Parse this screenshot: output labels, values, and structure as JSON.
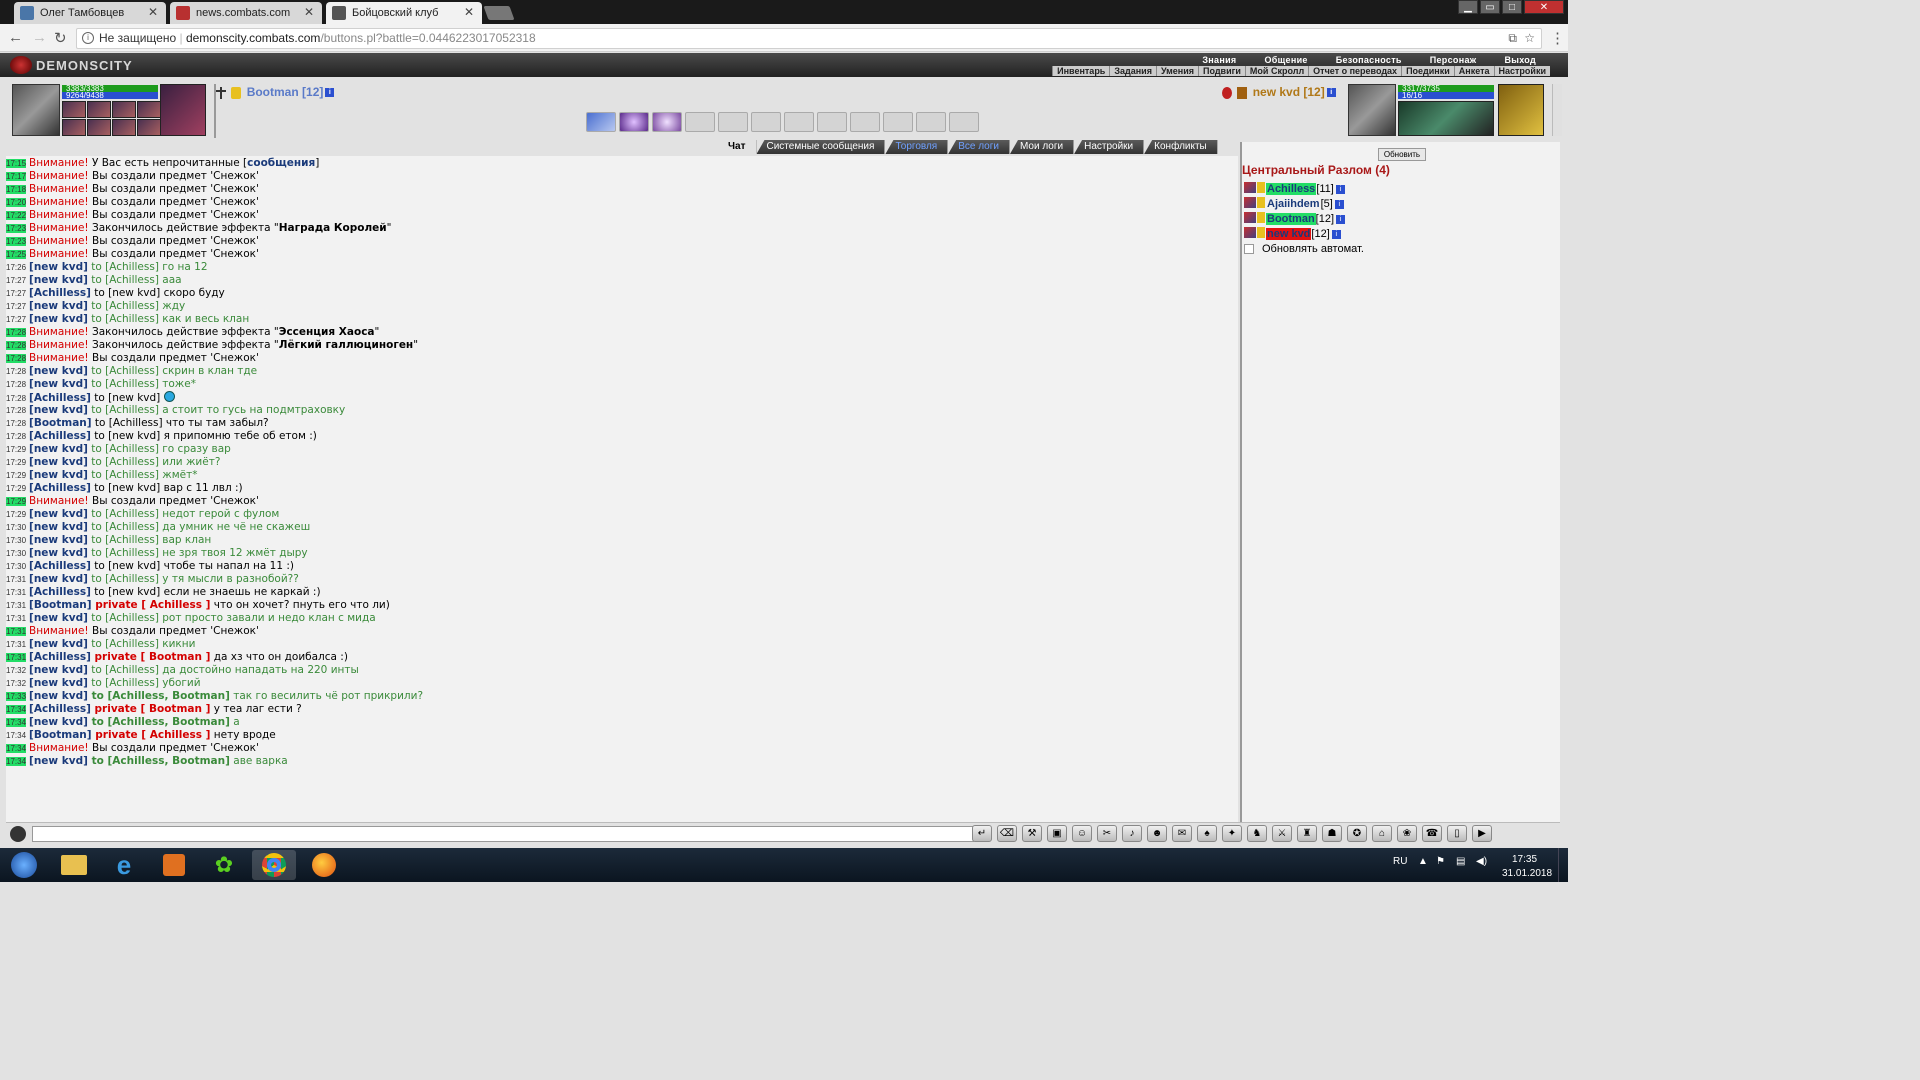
{
  "browser": {
    "tabs": [
      {
        "title": "Олег Тамбовцев",
        "fav": "#4a76a8"
      },
      {
        "title": "news.combats.com",
        "fav": "#b83030"
      },
      {
        "title": "Бойцовский клуб",
        "fav": "#555555"
      }
    ],
    "security": "Не защищено",
    "url_host": "demonscity.combats.com",
    "url_rest": "/buttons.pl?battle=0.0446223017052318"
  },
  "game": {
    "logo": "DEMONSCITY",
    "menu_top": [
      "Знания",
      "Общение",
      "Безопасность",
      "Персонаж",
      "Выход"
    ],
    "menu_bottom": [
      "Инвентарь",
      "Задания",
      "Умения",
      "Подвиги",
      "Мой Скролл",
      "Отчет о переводах",
      "Поединки",
      "Анкета",
      "Настройки"
    ]
  },
  "player_left": {
    "hp": "3383/3383",
    "mana": "9264/9438",
    "name": "Bootman [12]"
  },
  "player_right": {
    "hp": "3317/3735",
    "mana": "16/16",
    "name": "new kvd [12]"
  },
  "chat_tabs": [
    "Чат",
    "Системные сообщения",
    "Торговля",
    "Все логи",
    "Мои логи",
    "Настройки",
    "Конфликты"
  ],
  "chat": [
    {
      "t": "17:15",
      "sys": true,
      "p": [
        [
          "warn",
          "Внимание! "
        ],
        [
          "",
          "У Вас есть непрочитанные ["
        ],
        [
          "nick",
          "сообщения"
        ],
        [
          "",
          "]"
        ]
      ]
    },
    {
      "t": "17:17",
      "sys": true,
      "p": [
        [
          "warn",
          "Внимание! "
        ],
        [
          "",
          "Вы создали предмет 'Снежок'"
        ]
      ]
    },
    {
      "t": "17:18",
      "sys": true,
      "p": [
        [
          "warn",
          "Внимание! "
        ],
        [
          "",
          "Вы создали предмет 'Снежок'"
        ]
      ]
    },
    {
      "t": "17:20",
      "sys": true,
      "p": [
        [
          "warn",
          "Внимание! "
        ],
        [
          "",
          "Вы создали предмет 'Снежок'"
        ]
      ]
    },
    {
      "t": "17:22",
      "sys": true,
      "p": [
        [
          "warn",
          "Внимание! "
        ],
        [
          "",
          "Вы создали предмет 'Снежок'"
        ]
      ]
    },
    {
      "t": "17:23",
      "sys": true,
      "p": [
        [
          "warn",
          "Внимание! "
        ],
        [
          "",
          "Закончилось действие эффекта \""
        ],
        [
          "bold",
          "Награда Королей"
        ],
        [
          "",
          "\""
        ]
      ]
    },
    {
      "t": "17:23",
      "sys": true,
      "p": [
        [
          "warn",
          "Внимание! "
        ],
        [
          "",
          "Вы создали предмет 'Снежок'"
        ]
      ]
    },
    {
      "t": "17:25",
      "sys": true,
      "p": [
        [
          "warn",
          "Внимание! "
        ],
        [
          "",
          "Вы создали предмет 'Снежок'"
        ]
      ]
    },
    {
      "t": "17:26",
      "p": [
        [
          "nick",
          "[new kvd]"
        ],
        [
          "green",
          " to [Achilless] го на 12"
        ]
      ]
    },
    {
      "t": "17:27",
      "p": [
        [
          "nick",
          "[new kvd]"
        ],
        [
          "green",
          " to [Achilless] ааа"
        ]
      ]
    },
    {
      "t": "17:27",
      "p": [
        [
          "nick",
          "[Achilless]"
        ],
        [
          "",
          " to [new kvd] скоро буду"
        ]
      ]
    },
    {
      "t": "17:27",
      "p": [
        [
          "nick",
          "[new kvd]"
        ],
        [
          "green",
          " to [Achilless] жду"
        ]
      ]
    },
    {
      "t": "17:27",
      "p": [
        [
          "nick",
          "[new kvd]"
        ],
        [
          "green",
          " to [Achilless] как и весь клан"
        ]
      ]
    },
    {
      "t": "17:28",
      "sys": true,
      "p": [
        [
          "warn",
          "Внимание! "
        ],
        [
          "",
          "Закончилось действие эффекта \""
        ],
        [
          "bold",
          "Эссенция Хаоса"
        ],
        [
          "",
          "\""
        ]
      ]
    },
    {
      "t": "17:28",
      "sys": true,
      "p": [
        [
          "warn",
          "Внимание! "
        ],
        [
          "",
          "Закончилось действие эффекта \""
        ],
        [
          "bold",
          "Лёгкий галлюциноген"
        ],
        [
          "",
          "\""
        ]
      ]
    },
    {
      "t": "17:28",
      "sys": true,
      "p": [
        [
          "warn",
          "Внимание! "
        ],
        [
          "",
          "Вы создали предмет 'Снежок'"
        ]
      ]
    },
    {
      "t": "17:28",
      "p": [
        [
          "nick",
          "[new kvd]"
        ],
        [
          "green",
          " to [Achilless] скрин в клан тде"
        ]
      ]
    },
    {
      "t": "17:28",
      "p": [
        [
          "nick",
          "[new kvd]"
        ],
        [
          "green",
          " to [Achilless] тоже*"
        ]
      ]
    },
    {
      "t": "17:28",
      "smile": true,
      "p": [
        [
          "nick",
          "[Achilless]"
        ],
        [
          "",
          " to [new kvd] "
        ]
      ]
    },
    {
      "t": "17:28",
      "p": [
        [
          "nick",
          "[new kvd]"
        ],
        [
          "green",
          " to [Achilless] а стоит то гусь на подмтраховку"
        ]
      ]
    },
    {
      "t": "17:28",
      "p": [
        [
          "nick",
          "[Bootman]"
        ],
        [
          "",
          " to [Achilless] что ты там забыл?"
        ]
      ]
    },
    {
      "t": "17:28",
      "p": [
        [
          "nick",
          "[Achilless]"
        ],
        [
          "",
          " to [new kvd] я припомню тебе об етом :)"
        ]
      ]
    },
    {
      "t": "17:29",
      "p": [
        [
          "nick",
          "[new kvd]"
        ],
        [
          "green",
          " to [Achilless] го сразу вар"
        ]
      ]
    },
    {
      "t": "17:29",
      "p": [
        [
          "nick",
          "[new kvd]"
        ],
        [
          "green",
          " to [Achilless] или жиёт?"
        ]
      ]
    },
    {
      "t": "17:29",
      "p": [
        [
          "nick",
          "[new kvd]"
        ],
        [
          "green",
          " to [Achilless] жмёт*"
        ]
      ]
    },
    {
      "t": "17:29",
      "p": [
        [
          "nick",
          "[Achilless]"
        ],
        [
          "",
          " to [new kvd] вар с 11 лвл :)"
        ]
      ]
    },
    {
      "t": "17:29",
      "sys": true,
      "p": [
        [
          "warn",
          "Внимание! "
        ],
        [
          "",
          "Вы создали предмет 'Снежок'"
        ]
      ]
    },
    {
      "t": "17:29",
      "p": [
        [
          "nick",
          "[new kvd]"
        ],
        [
          "green",
          " to [Achilless] недот герой с фулом"
        ]
      ]
    },
    {
      "t": "17:30",
      "p": [
        [
          "nick",
          "[new kvd]"
        ],
        [
          "green",
          " to [Achilless] да умник не чё не скажеш"
        ]
      ]
    },
    {
      "t": "17:30",
      "p": [
        [
          "nick",
          "[new kvd]"
        ],
        [
          "green",
          " to [Achilless] вар клан"
        ]
      ]
    },
    {
      "t": "17:30",
      "p": [
        [
          "nick",
          "[new kvd]"
        ],
        [
          "green",
          " to [Achilless] не зря твоя 12 жмёт дыру"
        ]
      ]
    },
    {
      "t": "17:30",
      "p": [
        [
          "nick",
          "[Achilless]"
        ],
        [
          "",
          " to [new kvd] чтобе ты напал на 11 :)"
        ]
      ]
    },
    {
      "t": "17:31",
      "p": [
        [
          "nick",
          "[new kvd]"
        ],
        [
          "green",
          " to [Achilless] у тя мысли в разнобой??"
        ]
      ]
    },
    {
      "t": "17:31",
      "p": [
        [
          "nick",
          "[Achilless]"
        ],
        [
          "",
          " to [new kvd] если не знаешь не каркай :)"
        ]
      ]
    },
    {
      "t": "17:31",
      "p": [
        [
          "nick",
          "[Bootman]"
        ],
        [
          "priv",
          " private [ Achilless ]"
        ],
        [
          "",
          " что он хочет? пнуть его что ли)"
        ]
      ]
    },
    {
      "t": "17:31",
      "p": [
        [
          "nick",
          "[new kvd]"
        ],
        [
          "green",
          " to [Achilless] рот просто завали и недо клан с мида"
        ]
      ]
    },
    {
      "t": "17:31",
      "sys": true,
      "p": [
        [
          "warn",
          "Внимание! "
        ],
        [
          "",
          "Вы создали предмет 'Снежок'"
        ]
      ]
    },
    {
      "t": "17:31",
      "p": [
        [
          "nick",
          "[new kvd]"
        ],
        [
          "green",
          " to [Achilless] кикни"
        ]
      ]
    },
    {
      "t": "17:31",
      "sys": true,
      "p": [
        [
          "nick",
          "[Achilless]"
        ],
        [
          "priv",
          " private [ Bootman ]"
        ],
        [
          "",
          " да хз что он доибалса :)"
        ]
      ]
    },
    {
      "t": "17:32",
      "p": [
        [
          "nick",
          "[new kvd]"
        ],
        [
          "green",
          " to [Achilless] да достойно нападать на 220 инты"
        ]
      ]
    },
    {
      "t": "17:32",
      "p": [
        [
          "nick",
          "[new kvd]"
        ],
        [
          "green",
          " to [Achilless] убогий"
        ]
      ]
    },
    {
      "t": "17:33",
      "sys": true,
      "p": [
        [
          "nick",
          "[new kvd]"
        ],
        [
          "togrp",
          " to [Achilless, Bootman]"
        ],
        [
          "green",
          " так го весилить чё рот прикрили?"
        ]
      ]
    },
    {
      "t": "17:34",
      "sys": true,
      "p": [
        [
          "nick",
          "[Achilless]"
        ],
        [
          "priv",
          " private [ Bootman ]"
        ],
        [
          "",
          " у теа лаг ести ?"
        ]
      ]
    },
    {
      "t": "17:34",
      "sys": true,
      "p": [
        [
          "nick",
          "[new kvd]"
        ],
        [
          "togrp",
          " to [Achilless, Bootman]"
        ],
        [
          "green",
          " а"
        ]
      ]
    },
    {
      "t": "17:34",
      "p": [
        [
          "nick",
          "[Bootman]"
        ],
        [
          "priv",
          " private [ Achilless ]"
        ],
        [
          "",
          " нету вроде"
        ]
      ]
    },
    {
      "t": "17:34",
      "sys": true,
      "p": [
        [
          "warn",
          "Внимание! "
        ],
        [
          "",
          "Вы создали предмет 'Снежок'"
        ]
      ]
    },
    {
      "t": "17:34",
      "sys": true,
      "p": [
        [
          "nick",
          "[new kvd]"
        ],
        [
          "togrp",
          " to [Achilless, Bootman]"
        ],
        [
          "green",
          " аве варка"
        ]
      ]
    }
  ],
  "right_panel": {
    "refresh": "Обновить",
    "location": "Центральный Разлом (4)",
    "players": [
      {
        "name": "Achilless",
        "level": "[11]",
        "hl": "g"
      },
      {
        "name": "Ajaiihdem",
        "level": "[5]",
        "hl": ""
      },
      {
        "name": "Bootman",
        "level": "[12]",
        "hl": "g"
      },
      {
        "name": "new kvd",
        "level": "[12]",
        "hl": "r"
      }
    ],
    "auto_refresh": "Обновлять автомат."
  },
  "taskbar": {
    "lang": "RU",
    "time": "17:35",
    "date": "31.01.2018"
  }
}
